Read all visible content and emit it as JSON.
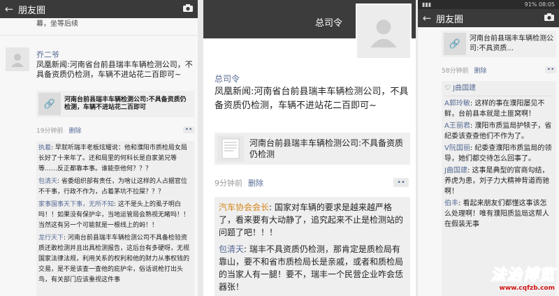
{
  "left": {
    "title": "朋友圈",
    "top_fragment": "幕，坐等后续",
    "post": {
      "author": "乔二爷",
      "text": "凤凰新闻:河南省台前县瑞丰车辆检测公司，不具备资质仍检测，车辆不进站花二百即可~",
      "link_title": "河南台前县瑞丰车辆检测公司:不具备资质仍检测，车辆不进站花二百即可",
      "time": "19分钟前",
      "delete": "删除"
    },
    "comments": [
      {
        "name": "执着",
        "text": ": 早就听瑞丰老板炫耀说：他和濮阳市质检局女局长好了十来年了。还和局里的何科长是自家弟兄等等……反正都靠本事。谁能奈他何？？？"
      },
      {
        "name": "包清天",
        "text": ": 省委组织部有责任，为啥让这样的人占据官位不干事，行政不作为，占着茅坑不拉屎？？？"
      },
      {
        "name": "家事国事天下事，无所不知",
        "text": ": 这不是头上的虱子明白吗！！如果没有保护伞，当地运管局会熟视无睹吗！！当然这有另一个可能就是一根线上的蚂！！"
      },
      {
        "name": "龙行天下",
        "text": ": 河南台前县瑞丰车辆检测公司不具备检验资质还敢检测并且出具检测报告，这后台有多硬呀，无视国家法律法规，利用关系的权利和他的财力从事权钱的交易，是不是该查一查他的庇护伞，俗话说枪打出头鸟，有关部门应该重视这件事"
      }
    ]
  },
  "mid": {
    "title": "总司令",
    "post": {
      "author": "总司令",
      "text": "凤凰新闻:河南省台前县瑞丰车辆检测公司，不具备资质仍检测，车辆不进站花二百即可~",
      "link_title": "河南台前县瑞丰车辆检测公司:不具备资质仍检测",
      "time": "9分钟前",
      "delete": "删除"
    },
    "comments": [
      {
        "name": "汽车协会会长",
        "text": ": 国家对车辆的要求是越来越严格了，看来要有大动静了，追究起来不止是检测站的问题了吧！！！"
      },
      {
        "name": "包清天",
        "text": ": 瑞丰不具资质仍检测，那肯定是质检局有靠山，要不和省市质检局长是亲戚，或者和质检局的当家人有一腿！要不，瑞丰一个民营企业咋会恁器张！"
      }
    ]
  },
  "right": {
    "status": {
      "time": "08:05",
      "battery": "91%"
    },
    "title": "朋友圈",
    "post": {
      "link_title": "河南台前县瑞丰车辆检测公司:不具资质...",
      "time": "58分钟前",
      "delete": "删除"
    },
    "likes": "J曲国建",
    "comments": [
      {
        "name": "A郭玲敏",
        "text": ": 这样的事在濮阳屡见不鲜，台前县本就是土匪窝啊！"
      },
      {
        "name": "A王丽君",
        "text": ": 濮阳市质监局护犊子，省纪委该查查他们不作为了。"
      },
      {
        "name": "V阮国丽",
        "text": ": 纪委查濮阳市质监局的领导，她们都交待怎么回事了。"
      },
      {
        "name": "J曲国建",
        "text": ": 这事是典型的官商勾结，养虎为患，刘子力大精神背道而驰啊！"
      },
      {
        "name": "伯丰",
        "text": ": 看起来朋友们都懂这事该怎么处理啊！唯有濮阳质监局这帮人在假装无事"
      }
    ]
  },
  "watermark": {
    "text": "法治博览",
    "url": "www.cqfzb.com"
  }
}
